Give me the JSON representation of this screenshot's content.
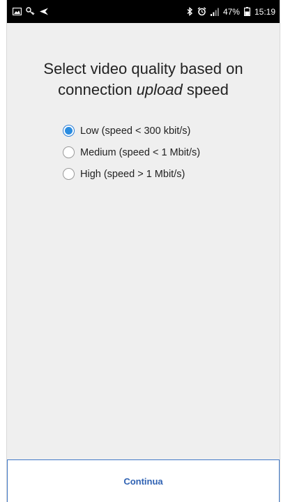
{
  "status_bar": {
    "battery_percent": "47%",
    "time": "15:19",
    "icons": [
      "image-icon",
      "key-icon",
      "send-icon",
      "bluetooth-icon",
      "alarm-icon",
      "signal-icon",
      "battery-icon"
    ]
  },
  "screen": {
    "title_line1": "Select video quality based on",
    "title_line2_before": "connection ",
    "title_line2_em": "upload",
    "title_line2_after": " speed"
  },
  "options": [
    {
      "label": "Low (speed < 300 kbit/s)",
      "selected": true
    },
    {
      "label": "Medium (speed < 1 Mbit/s)",
      "selected": false
    },
    {
      "label": "High (speed > 1 Mbit/s)",
      "selected": false
    }
  ],
  "footer": {
    "continue_label": "Continua"
  },
  "colors": {
    "accent": "#2a8ce0",
    "button_text": "#2f62b3",
    "background": "#efefef"
  }
}
